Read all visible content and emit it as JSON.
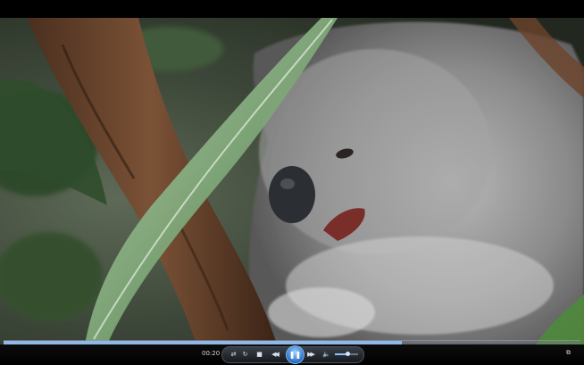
{
  "player": {
    "current_time": "00:20",
    "seek_progress": 0.69,
    "volume_level": 0.55,
    "icons": {
      "shuffle": "shuffle-icon",
      "repeat": "repeat-icon",
      "stop": "stop-icon",
      "previous": "previous-icon",
      "play_pause": "pause-icon",
      "next": "next-icon",
      "mute": "speaker-icon",
      "switch_to_library": "switch-to-library-icon"
    },
    "glyphs": {
      "shuffle": "⇄",
      "repeat": "↻",
      "stop": "■",
      "previous": "◀◀",
      "play_pause": "❚❚",
      "next": "▶▶",
      "mute": "🔈",
      "switch_to_library": "⧉"
    },
    "colors": {
      "accent": "#2b6fc4",
      "seek_fill": "#8fb8e8",
      "background": "#000000"
    }
  }
}
